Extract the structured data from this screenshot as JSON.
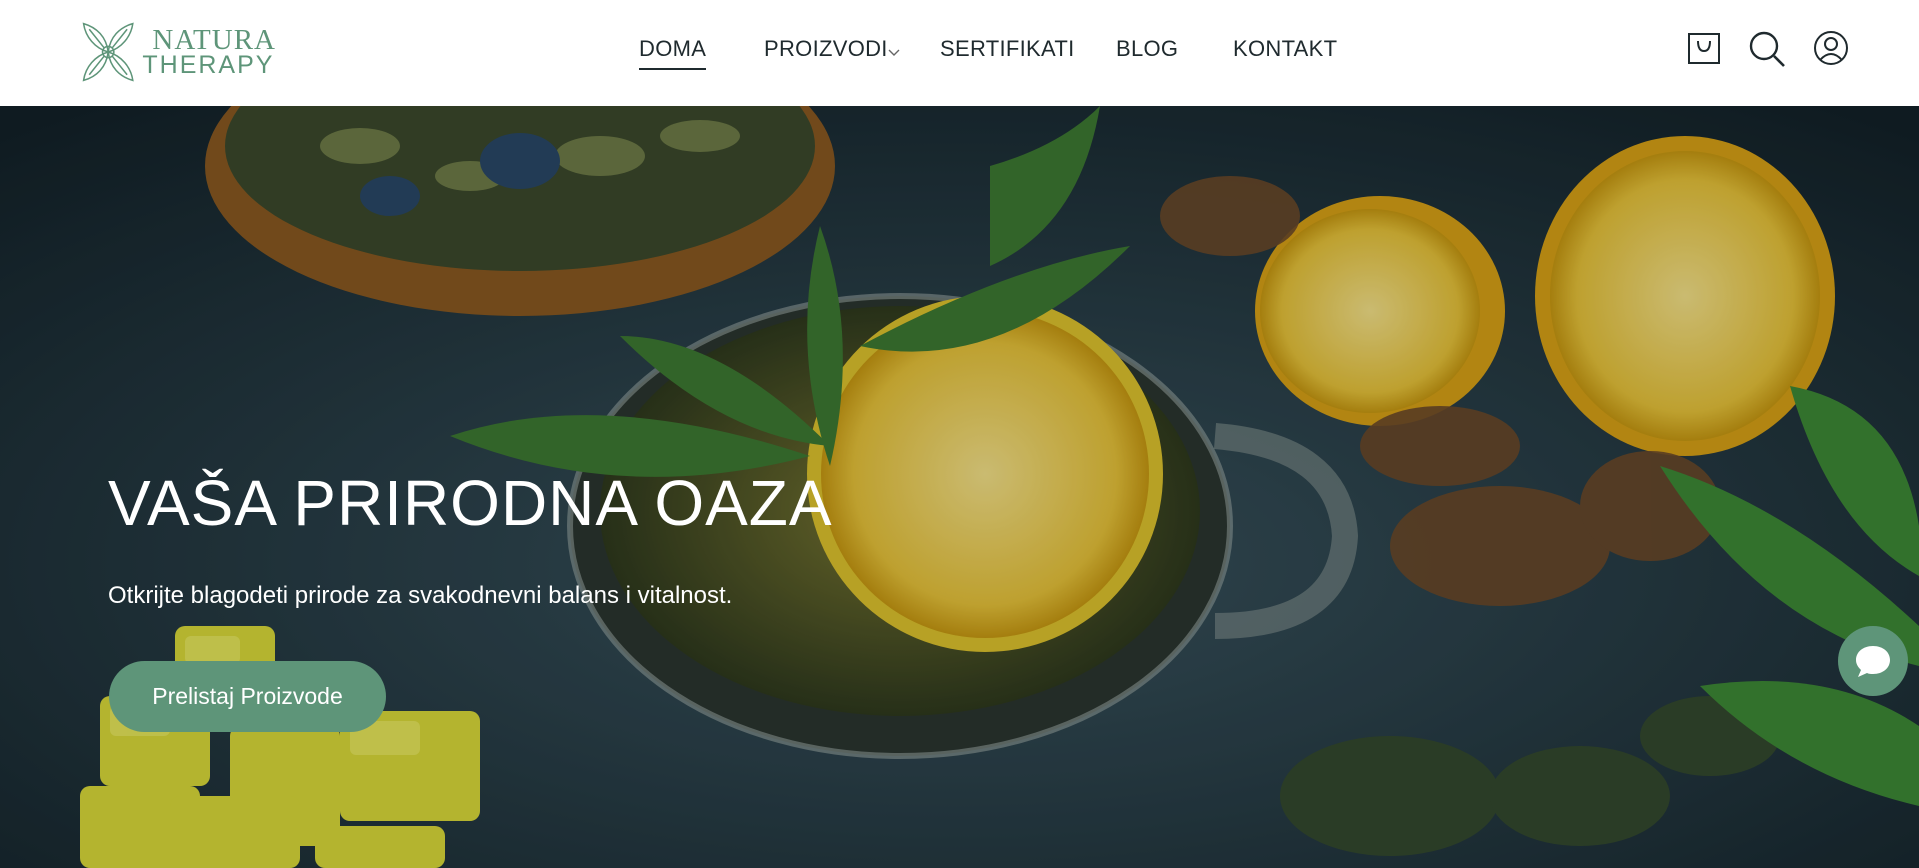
{
  "brand": {
    "logo_line1": "NATURA",
    "logo_line2": "THERAPY",
    "accent_color": "#5e9579"
  },
  "nav": {
    "items": [
      {
        "label": "DOMA",
        "active": true
      },
      {
        "label": "PROIZVODI",
        "has_dropdown": true
      },
      {
        "label": "SERTIFIKATI"
      },
      {
        "label": "BLOG"
      },
      {
        "label": "KONTAKT"
      }
    ]
  },
  "header_icons": [
    "shopping-bag-icon",
    "search-icon",
    "user-icon"
  ],
  "hero": {
    "title": "VAŠA PRIRODNA OAZA",
    "subtitle": "Otkrijte blagodeti prirode za svakodnevni balans i vitalnost.",
    "cta_label": "Prelistaj Proizvode"
  },
  "chat": {
    "icon": "chat-bubble-icon"
  }
}
